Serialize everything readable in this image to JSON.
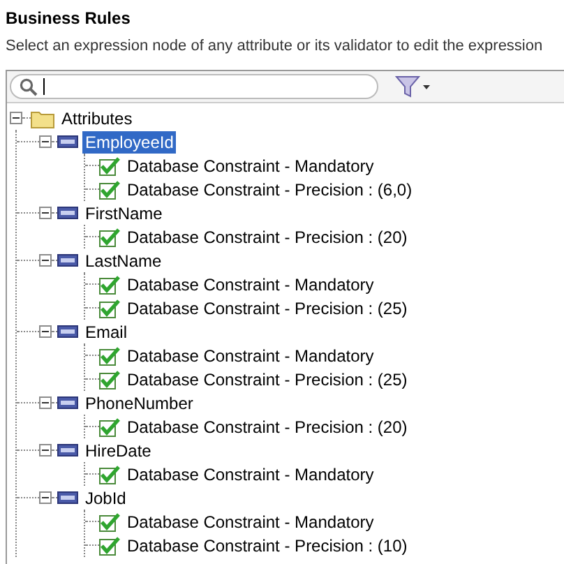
{
  "title": "Business Rules",
  "instruction": "Select an expression node of any attribute or its validator to edit the expression",
  "tree": {
    "label": "Attributes",
    "expanded": true,
    "children": [
      {
        "label": "EmployeeId",
        "selected": true,
        "expanded": true,
        "children": [
          {
            "label": "Database Constraint - Mandatory"
          },
          {
            "label": "Database Constraint - Precision : (6,0)"
          }
        ]
      },
      {
        "label": "FirstName",
        "selected": false,
        "expanded": true,
        "children": [
          {
            "label": "Database Constraint - Precision : (20)"
          }
        ]
      },
      {
        "label": "LastName",
        "selected": false,
        "expanded": true,
        "children": [
          {
            "label": "Database Constraint - Mandatory"
          },
          {
            "label": "Database Constraint - Precision : (25)"
          }
        ]
      },
      {
        "label": "Email",
        "selected": false,
        "expanded": true,
        "children": [
          {
            "label": "Database Constraint - Mandatory"
          },
          {
            "label": "Database Constraint - Precision : (25)"
          }
        ]
      },
      {
        "label": "PhoneNumber",
        "selected": false,
        "expanded": true,
        "children": [
          {
            "label": "Database Constraint - Precision : (20)"
          }
        ]
      },
      {
        "label": "HireDate",
        "selected": false,
        "expanded": true,
        "children": [
          {
            "label": "Database Constraint - Mandatory"
          }
        ]
      },
      {
        "label": "JobId",
        "selected": false,
        "expanded": true,
        "children": [
          {
            "label": "Database Constraint - Mandatory"
          },
          {
            "label": "Database Constraint - Precision : (10)"
          }
        ]
      }
    ]
  }
}
